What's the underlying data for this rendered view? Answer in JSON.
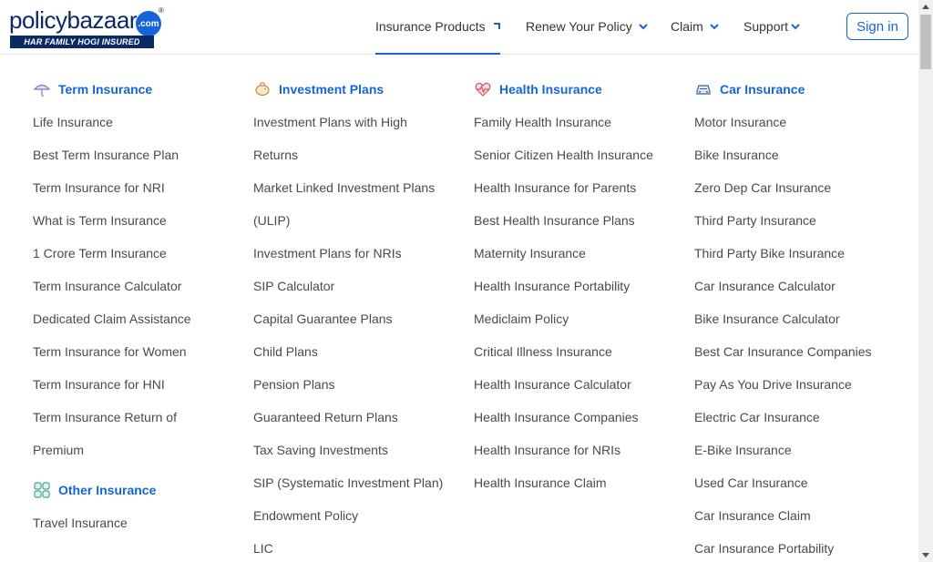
{
  "logo": {
    "policy": "policy",
    "bazaar": "bazaar",
    "com": ".com",
    "reg": "®",
    "tagline": "HAR FAMILY HOGI INSURED"
  },
  "nav": {
    "items": [
      {
        "label": "Insurance Products",
        "icon": "chevron-up-icon",
        "active": true
      },
      {
        "label": "Renew Your Policy",
        "icon": "chevron-down-icon"
      },
      {
        "label": "Claim",
        "icon": "chevron-down-icon"
      },
      {
        "label": "Support",
        "icon": "chevron-down-icon"
      }
    ],
    "sign_in": "Sign in"
  },
  "accent_color": "#1565d8",
  "columns": [
    {
      "title": "Term Insurance",
      "icon": "umbrella-icon",
      "items": [
        "Life Insurance",
        "Best Term Insurance Plan",
        "Term Insurance for NRI",
        "What is Term Insurance",
        "1 Crore Term Insurance",
        "Term Insurance Calculator",
        "Dedicated Claim Assistance",
        "Term Insurance for Women",
        "Term Insurance for HNI",
        "Term Insurance Return of",
        "Premium"
      ],
      "sub_title": "Other Insurance",
      "sub_icon": "grid-icon",
      "sub_items": [
        "Travel Insurance"
      ]
    },
    {
      "title": "Investment Plans",
      "icon": "piggy-bank-icon",
      "items": [
        "Investment Plans with High",
        "Returns",
        "Market Linked Investment Plans",
        "(ULIP)",
        "Investment Plans for NRIs",
        "SIP Calculator",
        "Capital Guarantee Plans",
        "Child Plans",
        "Pension Plans",
        "Guaranteed Return Plans",
        "Tax Saving Investments",
        "SIP (Systematic Investment Plan)",
        "Endowment Policy",
        "LIC"
      ]
    },
    {
      "title": "Health Insurance",
      "icon": "heartbeat-icon",
      "items": [
        "Family Health Insurance",
        "Senior Citizen Health Insurance",
        "Health Insurance for Parents",
        "Best Health Insurance Plans",
        "Maternity Insurance",
        "Health Insurance Portability",
        "Mediclaim Policy",
        "Critical Illness Insurance",
        "Health Insurance Calculator",
        "Health Insurance Companies",
        "Health Insurance for NRIs",
        "Health Insurance Claim"
      ]
    },
    {
      "title": "Car Insurance",
      "icon": "car-icon",
      "items": [
        "Motor Insurance",
        "Bike Insurance",
        "Zero Dep Car Insurance",
        "Third Party Insurance",
        "Third Party Bike Insurance",
        "Car Insurance Calculator",
        "Bike Insurance Calculator",
        "Best Car Insurance Companies",
        "Pay As You Drive Insurance",
        "Electric Car Insurance",
        "E-Bike Insurance",
        "Used Car Insurance",
        "Car Insurance Claim",
        "Car Insurance Portability"
      ]
    }
  ]
}
